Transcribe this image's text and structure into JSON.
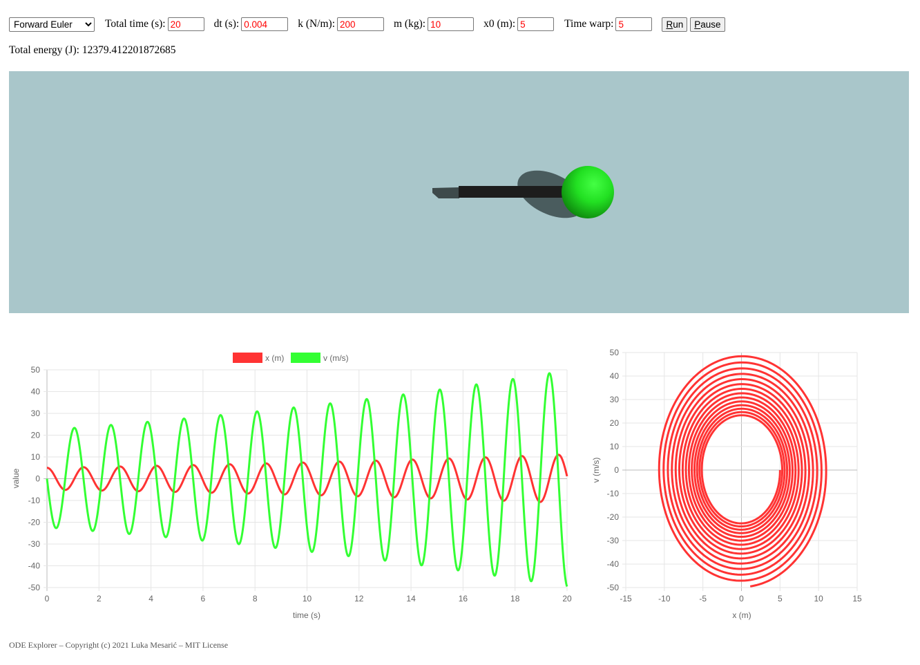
{
  "controls": {
    "method": {
      "selected": "Forward Euler",
      "options": [
        "Forward Euler"
      ]
    },
    "total_time": {
      "label": "Total time (s):",
      "value": "20"
    },
    "dt": {
      "label": "dt (s):",
      "value": "0.004"
    },
    "k": {
      "label": "k (N/m):",
      "value": "200"
    },
    "m": {
      "label": "m (kg):",
      "value": "10"
    },
    "x0": {
      "label": "x0 (m):",
      "value": "5"
    },
    "time_warp": {
      "label": "Time warp:",
      "value": "5"
    },
    "run_label_key": "R",
    "run_label_rest": "un",
    "pause_label_key": "P",
    "pause_label_rest": "ause"
  },
  "energy": {
    "label": "Total energy (J):",
    "value": "12379.412201872685"
  },
  "colors": {
    "scene_bg": "#a9c6ca",
    "x_series": "#ff3333",
    "v_series": "#33ff33",
    "ball": "#22dd22",
    "input_text": "#ff0000"
  },
  "chart_data": [
    {
      "type": "line",
      "xlabel": "time (s)",
      "ylabel": "value",
      "xlim": [
        0,
        20
      ],
      "ylim": [
        -50,
        50
      ],
      "x_ticks": [
        "0",
        "2",
        "4",
        "6",
        "8",
        "10",
        "12",
        "14",
        "16",
        "18",
        "20"
      ],
      "y_ticks": [
        "50",
        "40",
        "30",
        "20",
        "10",
        "0",
        "-10",
        "-20",
        "-30",
        "-40",
        "-50"
      ],
      "grid": true,
      "legend_position": "top",
      "series": [
        {
          "name": "x (m)",
          "color": "#ff3333",
          "x0": 5,
          "dt": 0.004,
          "k": 200,
          "m": 10,
          "t_end": 20,
          "method": "Forward Euler",
          "quantity": "x"
        },
        {
          "name": "v (m/s)",
          "color": "#33ff33",
          "x0": 5,
          "dt": 0.004,
          "k": 200,
          "m": 10,
          "t_end": 20,
          "method": "Forward Euler",
          "quantity": "v"
        }
      ]
    },
    {
      "type": "scatter",
      "xlabel": "x (m)",
      "ylabel": "v (m/s)",
      "xlim": [
        -15,
        15
      ],
      "ylim": [
        -50,
        50
      ],
      "x_ticks": [
        "-15",
        "-10",
        "-5",
        "0",
        "5",
        "10",
        "15"
      ],
      "y_ticks": [
        "50",
        "40",
        "30",
        "20",
        "10",
        "0",
        "-10",
        "-20",
        "-30",
        "-40",
        "-50"
      ],
      "grid": true,
      "series": [
        {
          "color": "#ff3333",
          "x0": 5,
          "dt": 0.004,
          "k": 200,
          "m": 10,
          "t_end": 20,
          "method": "Forward Euler"
        }
      ]
    }
  ],
  "footer": "ODE Explorer – Copyright (c) 2021 Luka Mesarić – MIT License"
}
